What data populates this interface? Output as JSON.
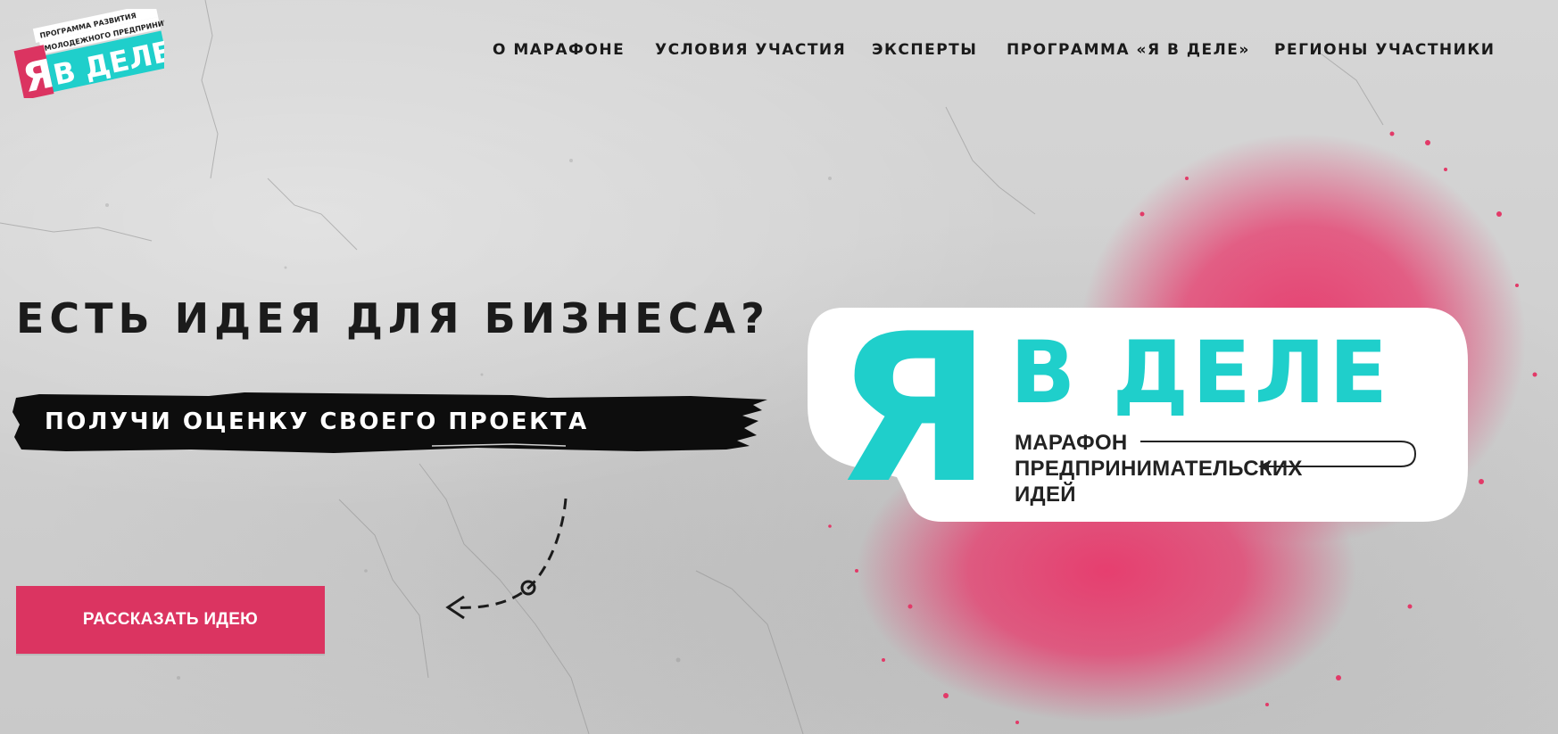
{
  "logo": {
    "subtitle_line1": "ПРОГРАММА РАЗВИТИЯ",
    "subtitle_line2": "МОЛОДЕЖНОГО ПРЕДПРИНИМАТЕЛЬСТВА",
    "mark": "Я",
    "name": "В ДЕЛЕ"
  },
  "nav": {
    "items": [
      {
        "label": "О МАРАФОНЕ"
      },
      {
        "label": "УСЛОВИЯ УЧАСТИЯ"
      },
      {
        "label": "ЭКСПЕРТЫ"
      },
      {
        "label": "ПРОГРАММА «Я В ДЕЛЕ»"
      },
      {
        "label": "РЕГИОНЫ УЧАСТНИКИ"
      }
    ]
  },
  "hero": {
    "headline": "ЕСТЬ ИДЕЯ ДЛЯ БИЗНЕСА?",
    "tagline": "ПОЛУЧИ ОЦЕНКУ СВОЕГО ПРОЕКТА",
    "cta_label": "РАССКАЗАТЬ ИДЕЮ"
  },
  "brand_sticker": {
    "mark": "Я",
    "title": "В ДЕЛЕ",
    "line1": "МАРАФОН",
    "line2": "ПРЕДПРИНИМАТЕЛЬСКИХ",
    "line3": "ИДЕЙ"
  },
  "colors": {
    "accent_teal": "#1fcfcb",
    "accent_pink": "#db3461",
    "text_dark": "#1b1b1b",
    "background": "#d2d2d2"
  }
}
